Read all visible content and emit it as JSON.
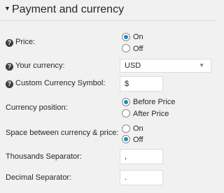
{
  "section": {
    "title": "Payment and currency"
  },
  "fields": {
    "price": {
      "label": "Price:",
      "options": [
        "On",
        "Off"
      ],
      "selected": "On"
    },
    "currency": {
      "label": "Your currency:",
      "value": "USD"
    },
    "custom_symbol": {
      "label": "Custom Currency Symbol:",
      "value": "$"
    },
    "position": {
      "label": "Currency position:",
      "options": [
        "Before Price",
        "After Price"
      ],
      "selected": "Before Price"
    },
    "space": {
      "label": "Space between currency & price:",
      "options": [
        "On",
        "Off"
      ],
      "selected": "Off"
    },
    "thousands": {
      "label": "Thousands Separator:",
      "value": ","
    },
    "decimal": {
      "label": "Decimal Separator:",
      "value": "."
    }
  },
  "icons": {
    "help": "?",
    "caret": "▼",
    "select_chevron": "▼"
  }
}
